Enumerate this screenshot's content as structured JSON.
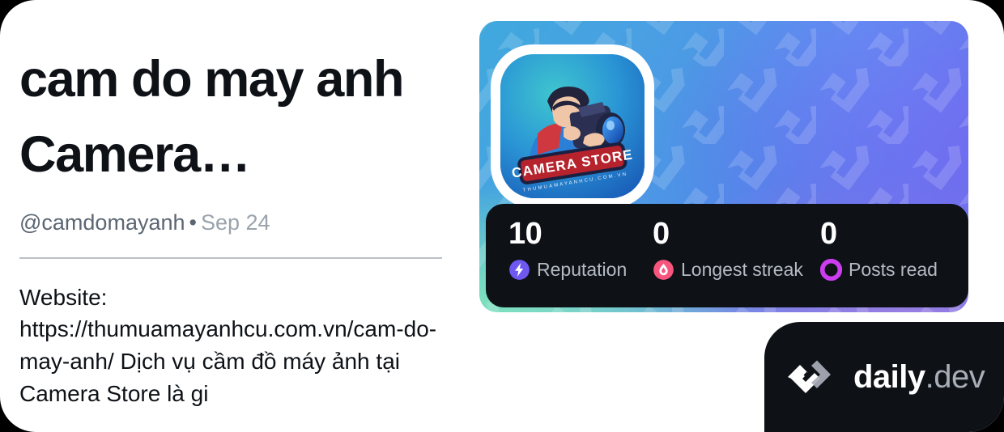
{
  "card": {
    "background_color": "#ffffff",
    "outer_background_color": "#000000"
  },
  "post": {
    "title": "cam do may anh Camera…",
    "author_handle": "@camdomayanh",
    "separator": "•",
    "date": "Sep 24",
    "body": "Website: https://thumuamayanhcu.com.vn/cam-do-may-anh/ Dịch vụ cầm đồ máy ảnh tại Camera Store là gi"
  },
  "cover": {
    "watermark_icon": "daily-dev-glyph-watermark",
    "gradient_colors": [
      "#74e0b9",
      "#3fa9dd",
      "#4f8ce8",
      "#6f6fea",
      "#9b7fe0"
    ],
    "avatar": {
      "icon": "camera-store-avatar",
      "banner_text": "CAMERA STORE",
      "sub_text": "THUMUAMAYANHCU.COM.VN",
      "border_color": "#ffffff"
    }
  },
  "stats": {
    "background_color": "#0e1217",
    "items": [
      {
        "value": "10",
        "label": "Reputation",
        "icon": "reputation-bolt-icon",
        "color": "#6e58f0"
      },
      {
        "value": "0",
        "label": "Longest streak",
        "icon": "streak-flame-icon",
        "color": "#f6567d"
      },
      {
        "value": "0",
        "label": "Posts read",
        "icon": "posts-read-ring-icon",
        "color": "#cc3df0"
      }
    ]
  },
  "brand": {
    "logo_icon": "daily-dev-logo-mark",
    "name": "daily",
    "tld": ".dev",
    "background_color": "#0e1217"
  }
}
